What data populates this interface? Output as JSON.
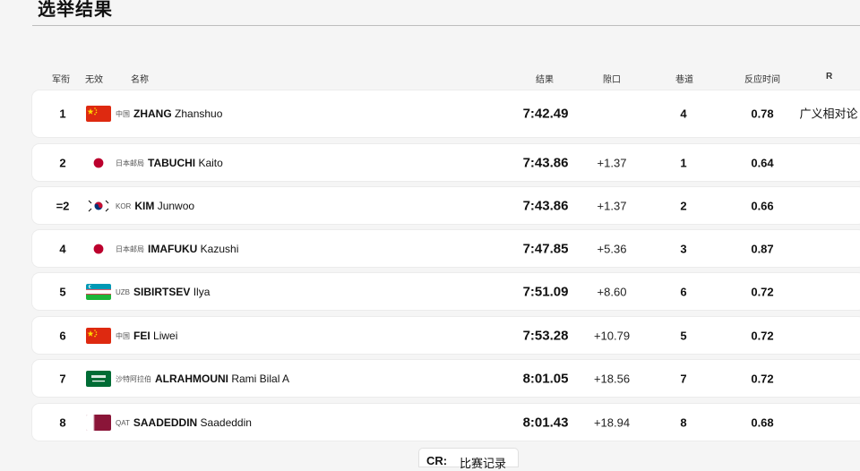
{
  "page_title": "选举结果",
  "columns": {
    "rank": "军衔",
    "invalid": "无效",
    "name": "名称",
    "result": "结果",
    "gap": "隙口",
    "lane": "巷道",
    "reaction": "反应时间",
    "remark": "R"
  },
  "rows": [
    {
      "rank": "1",
      "flag": "china-flag-icon",
      "noc": "中国",
      "surname": "ZHANG",
      "given": "Zhanshuo",
      "result": "7:42.49",
      "gap": "",
      "lane": "4",
      "reaction": "0.78",
      "remark": "广义相对论"
    },
    {
      "rank": "2",
      "flag": "japan-flag-icon",
      "noc": "日本邮局",
      "surname": "TABUCHI",
      "given": "Kaito",
      "result": "7:43.86",
      "gap": "+1.37",
      "lane": "1",
      "reaction": "0.64",
      "remark": ""
    },
    {
      "rank": "=2",
      "flag": "korea-flag-icon",
      "noc": "KOR",
      "surname": "KIM",
      "given": "Junwoo",
      "result": "7:43.86",
      "gap": "+1.37",
      "lane": "2",
      "reaction": "0.66",
      "remark": ""
    },
    {
      "rank": "4",
      "flag": "japan-flag-icon",
      "noc": "日本邮局",
      "surname": "IMAFUKU",
      "given": "Kazushi",
      "result": "7:47.85",
      "gap": "+5.36",
      "lane": "3",
      "reaction": "0.87",
      "remark": ""
    },
    {
      "rank": "5",
      "flag": "uzbekistan-flag-icon",
      "noc": "UZB",
      "surname": "SIBIRTSEV",
      "given": "Ilya",
      "result": "7:51.09",
      "gap": "+8.60",
      "lane": "6",
      "reaction": "0.72",
      "remark": ""
    },
    {
      "rank": "6",
      "flag": "china-flag-icon",
      "noc": "中国",
      "surname": "FEI",
      "given": "Liwei",
      "result": "7:53.28",
      "gap": "+10.79",
      "lane": "5",
      "reaction": "0.72",
      "remark": ""
    },
    {
      "rank": "7",
      "flag": "saudi-arabia-flag-icon",
      "noc": "沙特阿拉伯",
      "surname": "ALRAHMOUNI",
      "given": "Rami Bilal A",
      "result": "8:01.05",
      "gap": "+18.56",
      "lane": "7",
      "reaction": "0.72",
      "remark": ""
    },
    {
      "rank": "8",
      "flag": "qatar-flag-icon",
      "noc": "QAT",
      "surname": "SAADEDDIN",
      "given": "Saadeddin",
      "result": "8:01.43",
      "gap": "+18.94",
      "lane": "8",
      "reaction": "0.68",
      "remark": ""
    }
  ],
  "footer": {
    "key": "CR:",
    "value": "比赛记录"
  },
  "colors": {
    "china": "#de2910",
    "japan": "#bc002d",
    "uzbekistan": "#0099b5",
    "saudi": "#006c35",
    "qatar": "#8a1538"
  }
}
